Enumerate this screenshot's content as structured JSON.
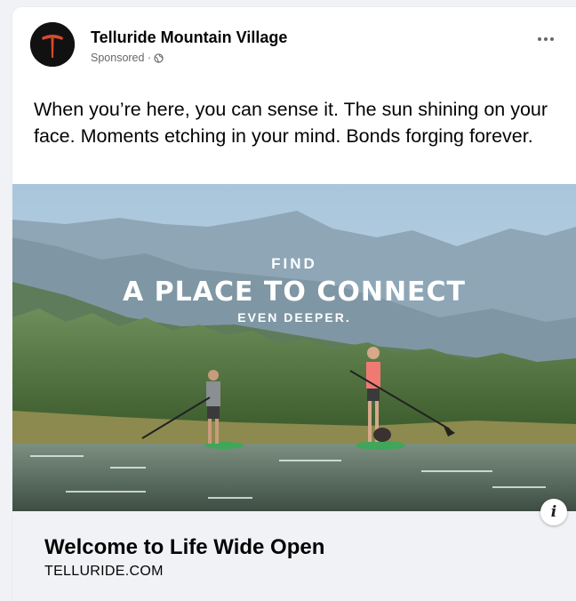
{
  "post": {
    "page_name": "Telluride Mountain Village",
    "sponsored_label": "Sponsored · ",
    "privacy_icon": "globe-icon",
    "more_icon": "more-options-icon",
    "caption": "When you’re here, you can sense it. The sun shining on your face. Moments etching in your mind. Bonds forging forever."
  },
  "media": {
    "overlay_line1": "FIND",
    "overlay_line2": "A PLACE TO CONNECT",
    "overlay_line3": "EVEN DEEPER.",
    "info_icon": "info-icon",
    "info_glyph": "i"
  },
  "link": {
    "title": "Welcome to Life Wide Open",
    "domain": "TELLURIDE.COM"
  },
  "colors": {
    "card_bg": "#ffffff",
    "link_bg": "#f0f2f5",
    "secondary_text": "#65676b",
    "primary_text": "#050505",
    "logo_bg": "#111111",
    "logo_accent": "#d94b2b"
  }
}
